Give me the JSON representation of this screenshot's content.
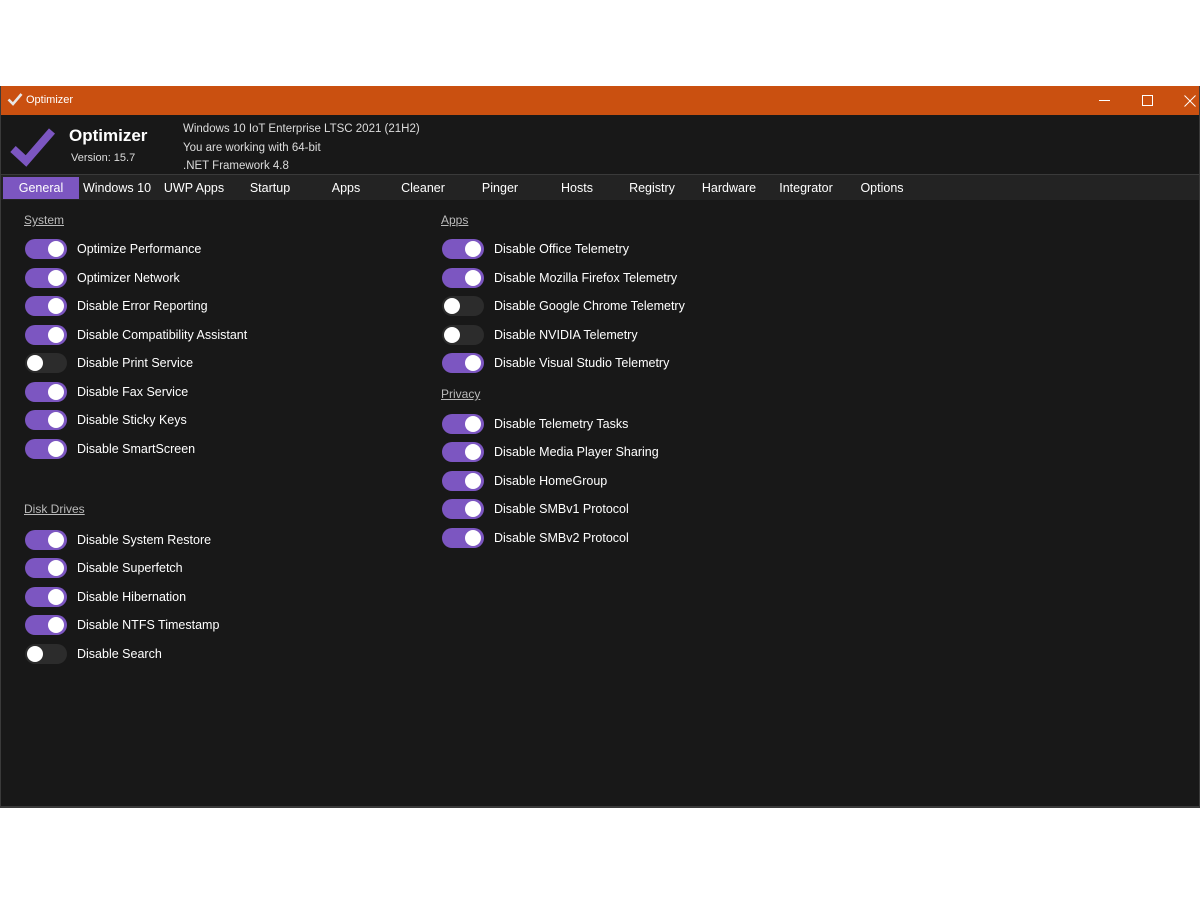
{
  "window": {
    "title": "Optimizer",
    "accent": "#ca5010",
    "toggle_on_color": "#7c56c1"
  },
  "header": {
    "app_name": "Optimizer",
    "version": "Version: 15.7",
    "os": "Windows 10 IoT Enterprise LTSC 2021 (21H2)",
    "arch": "You are working with 64-bit",
    "framework": ".NET Framework 4.8"
  },
  "tabs": [
    {
      "label": "General",
      "active": true
    },
    {
      "label": "Windows 10"
    },
    {
      "label": "UWP Apps"
    },
    {
      "label": "Startup"
    },
    {
      "label": "Apps"
    },
    {
      "label": "Cleaner"
    },
    {
      "label": "Pinger"
    },
    {
      "label": "Hosts"
    },
    {
      "label": "Registry"
    },
    {
      "label": "Hardware"
    },
    {
      "label": "Integrator"
    },
    {
      "label": "Options"
    }
  ],
  "sections": {
    "system": {
      "title": "System",
      "items": [
        {
          "label": "Optimize Performance",
          "on": true
        },
        {
          "label": "Optimizer Network",
          "on": true
        },
        {
          "label": "Disable Error Reporting",
          "on": true
        },
        {
          "label": "Disable Compatibility Assistant",
          "on": true
        },
        {
          "label": "Disable Print Service",
          "on": false
        },
        {
          "label": "Disable Fax Service",
          "on": true
        },
        {
          "label": "Disable Sticky Keys",
          "on": true
        },
        {
          "label": "Disable SmartScreen",
          "on": true
        }
      ]
    },
    "disk": {
      "title": "Disk Drives",
      "items": [
        {
          "label": "Disable System Restore",
          "on": true
        },
        {
          "label": "Disable Superfetch",
          "on": true
        },
        {
          "label": "Disable Hibernation",
          "on": true
        },
        {
          "label": "Disable NTFS Timestamp",
          "on": true
        },
        {
          "label": "Disable Search",
          "on": false
        }
      ]
    },
    "apps": {
      "title": "Apps",
      "items": [
        {
          "label": "Disable Office Telemetry",
          "on": true
        },
        {
          "label": "Disable Mozilla Firefox Telemetry",
          "on": true
        },
        {
          "label": "Disable Google Chrome Telemetry",
          "on": false
        },
        {
          "label": "Disable NVIDIA Telemetry",
          "on": false
        },
        {
          "label": "Disable Visual Studio Telemetry",
          "on": true
        }
      ]
    },
    "privacy": {
      "title": "Privacy",
      "items": [
        {
          "label": "Disable Telemetry Tasks",
          "on": true
        },
        {
          "label": "Disable Media Player Sharing",
          "on": true
        },
        {
          "label": "Disable HomeGroup",
          "on": true
        },
        {
          "label": "Disable SMBv1 Protocol",
          "on": true
        },
        {
          "label": "Disable SMBv2 Protocol",
          "on": true
        }
      ]
    }
  }
}
